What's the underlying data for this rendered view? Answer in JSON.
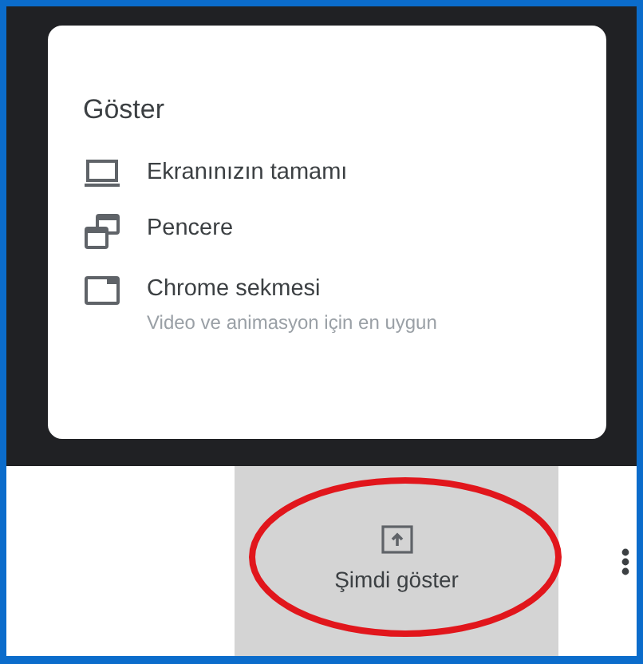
{
  "menu": {
    "title": "Göster",
    "items": [
      {
        "kind": "screen",
        "label": "Ekranınızın tamamı"
      },
      {
        "kind": "window",
        "label": "Pencere"
      },
      {
        "kind": "tab",
        "label": "Chrome sekmesi",
        "subtitle": "Video ve animasyon için en uygun"
      }
    ]
  },
  "present_button": {
    "label": "Şimdi göster",
    "highlighted": true
  }
}
